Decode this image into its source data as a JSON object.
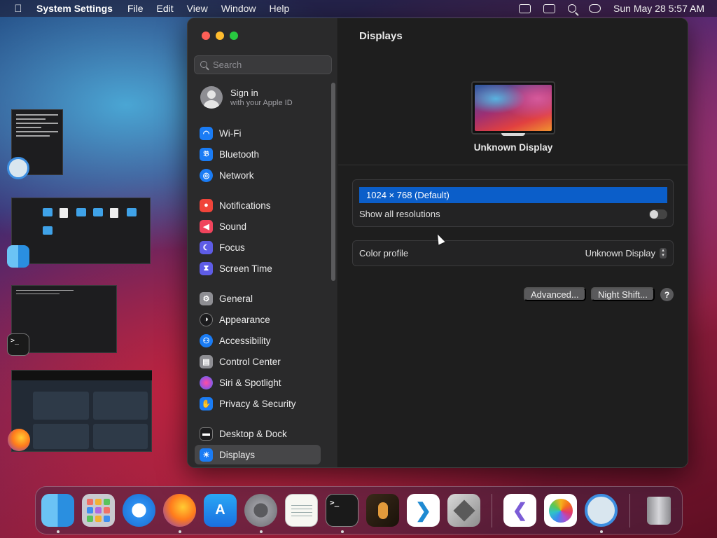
{
  "menubar": {
    "apple_icon": "apple-logo",
    "app_name": "System Settings",
    "items": [
      "File",
      "Edit",
      "View",
      "Window",
      "Help"
    ],
    "status_icons": [
      "keyboard-input-icon",
      "screen-mirroring-icon",
      "spotlight-search-icon",
      "control-center-icon"
    ],
    "datetime": "Sun May 28  5:57 AM"
  },
  "window": {
    "traffic_lights": [
      "close",
      "minimize",
      "zoom"
    ],
    "sidebar": {
      "search_placeholder": "Search",
      "account": {
        "title": "Sign in",
        "subtitle": "with your Apple ID"
      },
      "items": [
        {
          "label": "Wi-Fi",
          "icon": "wifi-icon",
          "color": "#1a7cf5"
        },
        {
          "label": "Bluetooth",
          "icon": "bluetooth-icon",
          "color": "#1a7cf5"
        },
        {
          "label": "Network",
          "icon": "globe-icon",
          "color": "#1a7cf5"
        },
        {
          "label": "Notifications",
          "icon": "bell-icon",
          "color": "#f0443a"
        },
        {
          "label": "Sound",
          "icon": "speaker-icon",
          "color": "#f0445c"
        },
        {
          "label": "Focus",
          "icon": "moon-icon",
          "color": "#5e5ce6"
        },
        {
          "label": "Screen Time",
          "icon": "hourglass-icon",
          "color": "#5e5ce6"
        },
        {
          "label": "General",
          "icon": "gear-icon",
          "color": "#8e8e93"
        },
        {
          "label": "Appearance",
          "icon": "appearance-icon",
          "color": "#1c1c1e"
        },
        {
          "label": "Accessibility",
          "icon": "accessibility-icon",
          "color": "#1a7cf5"
        },
        {
          "label": "Control Center",
          "icon": "control-center-icon",
          "color": "#8e8e93"
        },
        {
          "label": "Siri & Spotlight",
          "icon": "siri-icon",
          "color": "#b04fd4"
        },
        {
          "label": "Privacy & Security",
          "icon": "hand-icon",
          "color": "#1a7cf5"
        },
        {
          "label": "Desktop & Dock",
          "icon": "dock-icon",
          "color": "#1c1c1e"
        },
        {
          "label": "Displays",
          "icon": "sun-icon",
          "color": "#1a7cf5"
        }
      ],
      "selected": "Displays"
    },
    "content": {
      "title": "Displays",
      "display_name": "Unknown Display",
      "resolution_selected": "1024 × 768 (Default)",
      "show_all_resolutions_label": "Show all resolutions",
      "show_all_resolutions_on": false,
      "color_profile_label": "Color profile",
      "color_profile_value": "Unknown Display",
      "advanced_button": "Advanced...",
      "night_shift_button": "Night Shift...",
      "help_button": "?"
    }
  },
  "dock": {
    "apps": [
      {
        "name": "Finder",
        "icon": "finder-icon",
        "running": true
      },
      {
        "name": "Launchpad",
        "icon": "launchpad-icon",
        "running": false
      },
      {
        "name": "Safari",
        "icon": "safari-icon",
        "running": false
      },
      {
        "name": "Firefox",
        "icon": "firefox-icon",
        "running": true
      },
      {
        "name": "App Store",
        "icon": "app-store-icon",
        "running": false
      },
      {
        "name": "System Settings",
        "icon": "system-settings-icon",
        "running": true
      },
      {
        "name": "TextEdit",
        "icon": "textedit-icon",
        "running": false
      },
      {
        "name": "Terminal",
        "icon": "terminal-icon",
        "running": true
      },
      {
        "name": "GarageBand",
        "icon": "guitar-icon",
        "running": false
      },
      {
        "name": "Visual Studio Code",
        "icon": "vscode-icon",
        "running": false
      },
      {
        "name": "Boot Camp Assistant",
        "icon": "bootcamp-icon",
        "running": false
      },
      {
        "name": "Visual Studio",
        "icon": "visual-studio-icon",
        "running": false
      },
      {
        "name": "Photos",
        "icon": "photos-icon",
        "running": false
      },
      {
        "name": "Screen Sharing",
        "icon": "screen-sharing-icon",
        "running": true
      },
      {
        "name": "Trash",
        "icon": "trash-icon",
        "running": false
      }
    ],
    "terminal_glyph": ">_"
  }
}
